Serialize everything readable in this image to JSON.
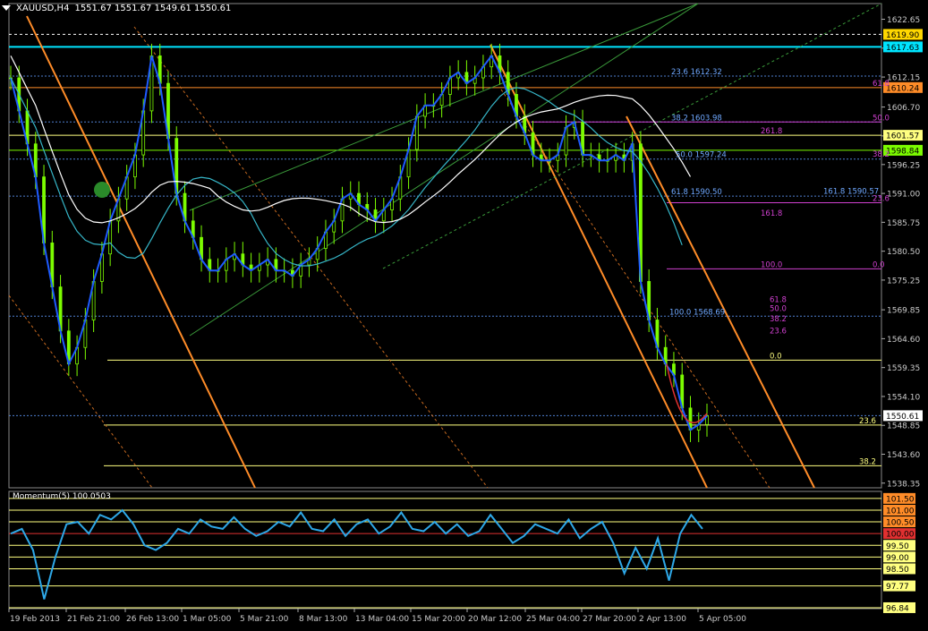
{
  "header": {
    "symbol": "XAUUSD,H4",
    "ohlc": "1551.67 1551.67 1549.61 1550.61"
  },
  "indicator": {
    "title": "Momentum(5) 100.0503"
  },
  "colors": {
    "background": "#000000",
    "candle": "#7CFC00",
    "ma_blue": "#1E5BFF",
    "ma_teal": "#36B6C8",
    "ma_white": "#FFFFFF",
    "orange": "#FF8C28",
    "cyan_line": "#00E5FF",
    "magenta": "#D040D0",
    "yellow": "#FFFF80",
    "momentum": "#2EA8E8"
  },
  "chart_data": [
    {
      "type": "line",
      "title": "XAUUSD,H4",
      "y_axis_ticks": [
        1622.65,
        1617.4,
        1612.15,
        1606.7,
        1601.45,
        1596.25,
        1591.0,
        1585.75,
        1580.5,
        1575.25,
        1569.85,
        1564.6,
        1559.35,
        1554.1,
        1548.85,
        1543.6,
        1538.35
      ],
      "ylim": [
        1537.5,
        1625.5
      ],
      "x_axis_labels": [
        "19 Feb 2013",
        "21 Feb 21:00",
        "26 Feb 13:00",
        "1 Mar 05:00",
        "5 Mar 21:00",
        "8 Mar 13:00",
        "13 Mar 04:00",
        "15 Mar 20:00",
        "20 Mar 12:00",
        "25 Mar 04:00",
        "27 Mar 20:00",
        "2 Apr 13:00",
        "5 Apr 05:00"
      ],
      "price_tags": [
        {
          "label": "1619.90",
          "value": 1619.9,
          "color": "#FFD700"
        },
        {
          "label": "1617.63",
          "value": 1617.63,
          "color": "#00E5FF"
        },
        {
          "label": "1610.24",
          "value": 1610.24,
          "color": "#FF8C28"
        },
        {
          "label": "1601.57",
          "value": 1601.57,
          "color": "#FFFF80"
        },
        {
          "label": "1598.84",
          "value": 1598.84,
          "color": "#7CFC00"
        },
        {
          "label": "1550.61",
          "value": 1550.61,
          "color": "#FFFFFF"
        }
      ],
      "fib_labels": [
        {
          "text": "23.6 1612.32",
          "value": 1612.32,
          "color": "#6FA8FF"
        },
        {
          "text": "61.8",
          "value": 1610.24,
          "color": "#D040D0"
        },
        {
          "text": "38.2 1603.98",
          "value": 1603.98,
          "color": "#6FA8FF"
        },
        {
          "text": "50.0",
          "value": 1603.98,
          "color": "#D040D0"
        },
        {
          "text": "261.8",
          "value": 1601.57,
          "color": "#D040D0"
        },
        {
          "text": "50.0 1597.24",
          "value": 1597.24,
          "color": "#6FA8FF"
        },
        {
          "text": "38.2",
          "value": 1597.4,
          "color": "#D040D0"
        },
        {
          "text": "61.8 1590.50",
          "value": 1590.5,
          "color": "#6FA8FF"
        },
        {
          "text": "161.8 1590.57",
          "value": 1590.57,
          "color": "#6FA8FF"
        },
        {
          "text": "23.6",
          "value": 1589.3,
          "color": "#D040D0"
        },
        {
          "text": "161.8",
          "value": 1586.6,
          "color": "#D040D0"
        },
        {
          "text": "100.0",
          "value": 1577.3,
          "color": "#D040D0"
        },
        {
          "text": "0.0",
          "value": 1577.3,
          "color": "#D040D0"
        },
        {
          "text": "61.8",
          "value": 1570.9,
          "color": "#D040D0"
        },
        {
          "text": "100.0 1568.69",
          "value": 1568.69,
          "color": "#6FA8FF"
        },
        {
          "text": "50.0",
          "value": 1569.3,
          "color": "#D040D0"
        },
        {
          "text": "38.2",
          "value": 1567.4,
          "color": "#D040D0"
        },
        {
          "text": "23.6",
          "value": 1565.2,
          "color": "#D040D0"
        },
        {
          "text": "0.0",
          "value": 1560.7,
          "color": "#FFFF80"
        },
        {
          "text": "23.6",
          "value": 1548.9,
          "color": "#FFFF80"
        },
        {
          "text": "38.2",
          "value": 1541.5,
          "color": "#FFFF80"
        }
      ],
      "series": [
        {
          "name": "XAUUSD",
          "values": [
            1612,
            1606,
            1600,
            1594,
            1582,
            1574,
            1566,
            1560,
            1563,
            1568,
            1575,
            1580,
            1586,
            1590,
            1594,
            1598,
            1606,
            1616,
            1611,
            1601,
            1591,
            1586,
            1583,
            1579,
            1577,
            1577,
            1579,
            1580,
            1578,
            1577,
            1578,
            1579,
            1577,
            1577,
            1576,
            1578,
            1579,
            1581,
            1584,
            1586,
            1590,
            1591,
            1589,
            1588,
            1586,
            1588,
            1590,
            1594,
            1599,
            1605,
            1607,
            1607,
            1609,
            1612,
            1613,
            1611,
            1612,
            1614,
            1616,
            1613,
            1609,
            1605,
            1602,
            1598,
            1597,
            1597,
            1598,
            1603,
            1604,
            1598,
            1598,
            1597,
            1597,
            1598,
            1597,
            1600,
            1575,
            1568,
            1563,
            1560,
            1558,
            1552,
            1548,
            1549,
            1550.6
          ]
        }
      ]
    },
    {
      "type": "line",
      "title": "Momentum(5) 100.0503",
      "y_axis_ticks": [
        101.5,
        101.0,
        100.5,
        100.0,
        99.5,
        99.0,
        98.5,
        97.77,
        96.84
      ],
      "tick_labels": [
        "101.50",
        "101.00",
        "100.50",
        "100.00",
        "99.50",
        "99.00",
        "98.50",
        "97.77",
        "96.84"
      ],
      "ylim": [
        96.8,
        101.8
      ],
      "series": [
        {
          "name": "Momentum",
          "values": [
            100.0,
            100.2,
            99.3,
            97.2,
            99.0,
            100.4,
            100.5,
            100.0,
            100.8,
            100.6,
            101.0,
            100.4,
            99.5,
            99.3,
            99.6,
            100.2,
            100.0,
            100.6,
            100.3,
            100.2,
            100.7,
            100.2,
            99.9,
            100.1,
            100.5,
            100.3,
            100.9,
            100.2,
            100.1,
            100.6,
            99.9,
            100.4,
            100.6,
            100.0,
            100.3,
            100.9,
            100.2,
            100.1,
            100.5,
            100.0,
            100.4,
            99.9,
            100.1,
            100.8,
            100.2,
            99.6,
            99.9,
            100.4,
            100.2,
            100.0,
            100.6,
            99.8,
            100.2,
            100.5,
            99.6,
            98.3,
            99.4,
            98.5,
            99.8,
            98.0,
            100.0,
            100.8,
            100.2
          ]
        }
      ]
    }
  ]
}
